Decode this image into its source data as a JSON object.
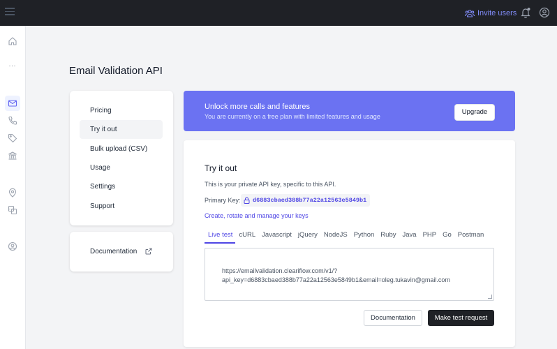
{
  "topbar": {
    "invite_label": "Invite users"
  },
  "page": {
    "title": "Email Validation API"
  },
  "menu": {
    "items": [
      {
        "label": "Pricing"
      },
      {
        "label": "Try it out"
      },
      {
        "label": "Bulk upload (CSV)"
      },
      {
        "label": "Usage"
      },
      {
        "label": "Settings"
      },
      {
        "label": "Support"
      }
    ],
    "active_item": "Try it out",
    "documentation_label": "Documentation"
  },
  "banner": {
    "title": "Unlock more calls and features",
    "subtitle": "You are currently on a free plan with limited features and usage",
    "upgrade_label": "Upgrade",
    "color": "#6b72f2"
  },
  "try_it_out": {
    "title": "Try it out",
    "description": "This is your private API key, specific to this API.",
    "primary_key_label": "Primary Key:",
    "primary_key_value": "d6883cbaed388b77a22a12563e5849b1",
    "manage_keys_label": "Create, rotate and manage your keys",
    "tabs": [
      "Live test",
      "cURL",
      "Javascript",
      "jQuery",
      "NodeJS",
      "Python",
      "Ruby",
      "Java",
      "PHP",
      "Go",
      "Postman"
    ],
    "active_tab": "Live test",
    "request_url_line1": "https://emailvalidation.cleariflow.com/v1/?",
    "request_url_line2": "api_key=d6883cbaed388b77a22a12563e5849b1&email=oleg.tukavin@gmail.com",
    "documentation_button": "Documentation",
    "make_request_button": "Make test request"
  },
  "colors": {
    "accent": "#4f46e5",
    "topbar": "#1f2126"
  }
}
